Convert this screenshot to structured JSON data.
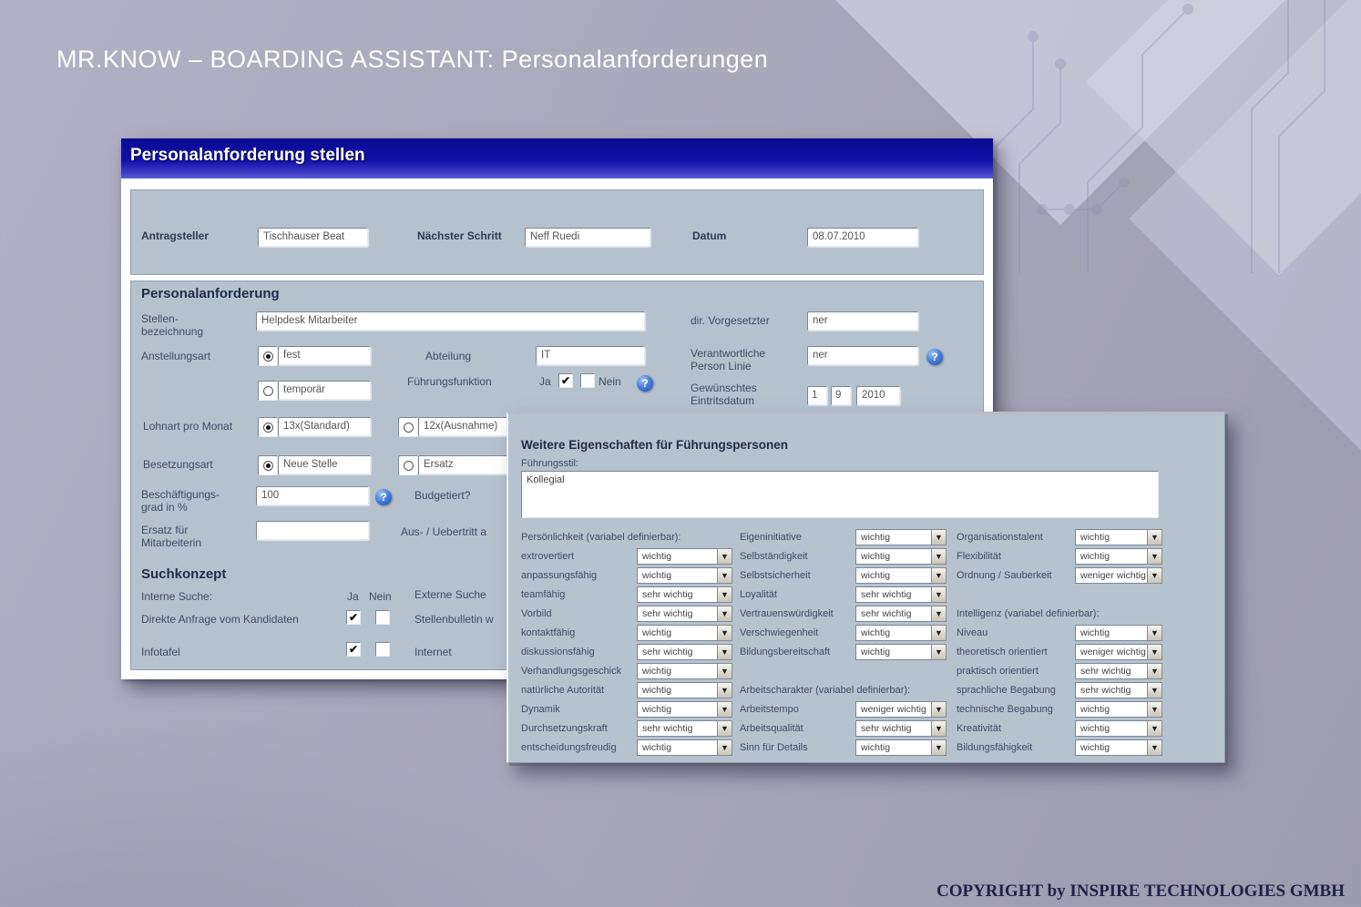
{
  "page": {
    "title": "MR.KNOW – BOARDING ASSISTANT: Personalanforderungen",
    "copyright": "COPYRIGHT by INSPIRE TECHNOLOGIES GMBH"
  },
  "colors": {
    "titlebar_blue": "#1111aa",
    "panel_bluegray": "#b6c1ce",
    "help_blue": "#1a4cb0",
    "background_lavender": "#a9a7ba"
  },
  "icons": {
    "help": "?",
    "check": "✔",
    "chevron": "▼"
  },
  "win1": {
    "title": "Personalanforderung stellen",
    "antragsteller_label": "Antragsteller",
    "antragsteller_value": "Tischhauser Beat",
    "naechster_schritt_label": "Nächster Schritt",
    "naechster_schritt_value": "Neff Ruedi",
    "datum_label": "Datum",
    "datum_value": "08.07.2010",
    "section_heading": "Personalanforderung",
    "stellenbezeichnung_label": "Stellen- bezeichnung",
    "stellenbezeichnung_value": "Helpdesk Mitarbeiter",
    "dir_vorgesetzter_label": "dir. Vorgesetzter",
    "dir_vorgesetzter_value": "ner",
    "anstellungsart_label": "Anstellungsart",
    "anstellungsart_opt1": "fest",
    "anstellungsart_opt2": "temporär",
    "abteilung_label": "Abteilung",
    "abteilung_value": "IT",
    "fuehrungsfunktion_label": "Führungsfunktion",
    "ja_label": "Ja",
    "nein_label": "Nein",
    "verantwortliche_label": "Verantwortliche Person Linie",
    "verantwortliche_value": "ner",
    "eintrittsdatum_label": "Gewünschtes Eintritsdatum",
    "eintritt_day": "1",
    "eintritt_month": "9",
    "eintritt_year": "2010",
    "lohnart_label": "Lohnart pro Monat",
    "lohnart_opt1": "13x(Standard)",
    "lohnart_opt2": "12x(Ausnahme)",
    "besetzungsart_label": "Besetzungsart",
    "besetzungsart_opt1": "Neue Stelle",
    "besetzungsart_opt2": "Ersatz",
    "beschaeftigungsgrad_label": "Beschäftigungs- grad in %",
    "beschaeftigungsgrad_value": "100",
    "budgetiert_label": "Budgetiert?",
    "ersatz_fuer_label": "Ersatz für Mitarbeiterin",
    "ersatz_fuer_value": "",
    "austritt_label": "Aus- / Uebertritt a",
    "suchkonzept_heading": "Suchkonzept",
    "interne_suche_label": "Interne Suche:",
    "externe_suche_label": "Externe Suche",
    "direkte_anfrage_label": "Direkte Anfrage vom Kandidaten",
    "stellenbulletin_label": "Stellenbulletin w",
    "infotafel_label": "Infotafel",
    "internet_label": "Internet"
  },
  "win2": {
    "heading": "Weitere Eigenschaften für Führungspersonen",
    "fuehrungsstil_label": "Führungsstil:",
    "fuehrungsstil_value": "Kollegial",
    "col1_header": "Persönlichkeit (variabel definierbar):",
    "col1": [
      {
        "label": "extrovertiert",
        "value": "wichtig"
      },
      {
        "label": "anpassungsfähig",
        "value": "wichtig"
      },
      {
        "label": "teamfähig",
        "value": "sehr wichtig"
      },
      {
        "label": "Vorbild",
        "value": "sehr wichtig"
      },
      {
        "label": "kontaktfähig",
        "value": "wichtig"
      },
      {
        "label": "diskussionsfähig",
        "value": "sehr wichtig"
      },
      {
        "label": "Verhandlungsgeschick",
        "value": "wichtig"
      },
      {
        "label": "natürliche Autorität",
        "value": "wichtig"
      },
      {
        "label": "Dynamik",
        "value": "wichtig"
      },
      {
        "label": "Durchsetzungskraft",
        "value": "sehr wichtig"
      },
      {
        "label": "entscheidungsfreudig",
        "value": "wichtig"
      }
    ],
    "col2": [
      {
        "label": "Eigeninitiative",
        "value": "wichtig"
      },
      {
        "label": "Selbständigkeit",
        "value": "wichtig"
      },
      {
        "label": "Selbstsicherheit",
        "value": "wichtig"
      },
      {
        "label": "Loyalität",
        "value": "sehr wichtig"
      },
      {
        "label": "Vertrauenswürdigkeit",
        "value": "sehr wichtig"
      },
      {
        "label": "Verschwiegenheit",
        "value": "wichtig"
      },
      {
        "label": "Bildungsbereitschaft",
        "value": "wichtig"
      }
    ],
    "col2b_header": "Arbeitscharakter (variabel definierbar):",
    "col2b": [
      {
        "label": "Arbeitstempo",
        "value": "weniger wichtig"
      },
      {
        "label": "Arbeitsqualität",
        "value": "sehr wichtig"
      },
      {
        "label": "Sinn für Details",
        "value": "wichtig"
      }
    ],
    "col3": [
      {
        "label": "Organisationstalent",
        "value": "wichtig"
      },
      {
        "label": "Flexibilität",
        "value": "wichtig"
      },
      {
        "label": "Ordnung / Sauberkeit",
        "value": "weniger wichtig"
      }
    ],
    "col3b_header": "Intelligenz (variabel definierbar):",
    "col3b": [
      {
        "label": "Niveau",
        "value": "wichtig"
      },
      {
        "label": "theoretisch orientiert",
        "value": "weniger wichtig"
      },
      {
        "label": "praktisch orientiert",
        "value": "sehr wichtig"
      },
      {
        "label": "sprachliche Begabung",
        "value": "sehr wichtig"
      },
      {
        "label": "technische Begabung",
        "value": "wichtig"
      },
      {
        "label": "Kreativität",
        "value": "wichtig"
      },
      {
        "label": "Bildungsfähigkeit",
        "value": "wichtig"
      }
    ]
  }
}
